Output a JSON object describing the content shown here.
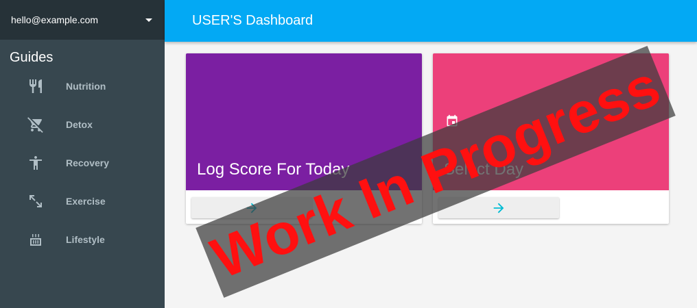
{
  "account": {
    "email": "hello@example.com",
    "menu_icon": "caret-down-icon"
  },
  "sidebar": {
    "heading": "Guides",
    "items": [
      {
        "label": "Nutrition",
        "icon": "fork-knife-icon"
      },
      {
        "label": "Detox",
        "icon": "no-cart-icon"
      },
      {
        "label": "Recovery",
        "icon": "accessibility-icon"
      },
      {
        "label": "Exercise",
        "icon": "expand-arrows-icon"
      },
      {
        "label": "Lifestyle",
        "icon": "kitchen-stove-icon"
      }
    ]
  },
  "header": {
    "title": "USER'S Dashboard"
  },
  "cards": [
    {
      "title": "Log Score For Today",
      "color": "#7b1fa2",
      "button_icon": "arrow-forward-icon"
    },
    {
      "title": "Select Day",
      "color": "#ec407a",
      "icon": "calendar-icon",
      "button_icon": "arrow-forward-icon"
    }
  ],
  "watermark": {
    "text": "Work In Progress"
  },
  "colors": {
    "appbar": "#03a9f4",
    "sidebar": "#37474f",
    "account_bar": "#263238",
    "button_icon": "#00bcd4",
    "watermark_text": "#ff1010"
  }
}
